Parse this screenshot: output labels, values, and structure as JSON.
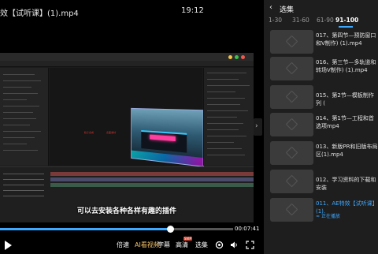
{
  "player": {
    "title": "效【试听课】(1).mp4",
    "clock": "19:12",
    "subtitle": "可以去安装各种各样有趣的插件",
    "current_time": "00:07:41",
    "progress_fraction": 0.73,
    "controls": {
      "speed_label": "倍速",
      "ai_label": "AI看视频",
      "subtitle_label": "字幕",
      "hd_label": "高清",
      "svip_badge": "SVIP",
      "episodes_label": "选集"
    }
  },
  "video_content": {
    "comp_labels": [
      "粒子合成",
      "表面素材"
    ]
  },
  "playlist": {
    "title": "选集",
    "tabs": [
      "1-30",
      "31-60",
      "61-90",
      "91-100"
    ],
    "active_tab": "91-100",
    "items": [
      {
        "text": "017、第四节—预防窗口和V制作) (1).mp4",
        "active": false
      },
      {
        "text": "016、第三节—多轨道和转场V制作) (1).mp4",
        "active": false
      },
      {
        "text": "015、第2节—模板制作列 (",
        "active": false
      },
      {
        "text": "014、第1节—工程和首选项mp4",
        "active": false
      },
      {
        "text": "013、新版PR和旧版布局区(1).mp4",
        "active": false
      },
      {
        "text": "012、学习资料的下载和安装",
        "active": false
      },
      {
        "text": "011、AE特效【试听课】(1).",
        "active": true,
        "status": "正在播放"
      }
    ]
  },
  "colors": {
    "accent": "#3ea8ff",
    "panel_bg": "#1e1e1e",
    "svip": "#d6442f"
  }
}
